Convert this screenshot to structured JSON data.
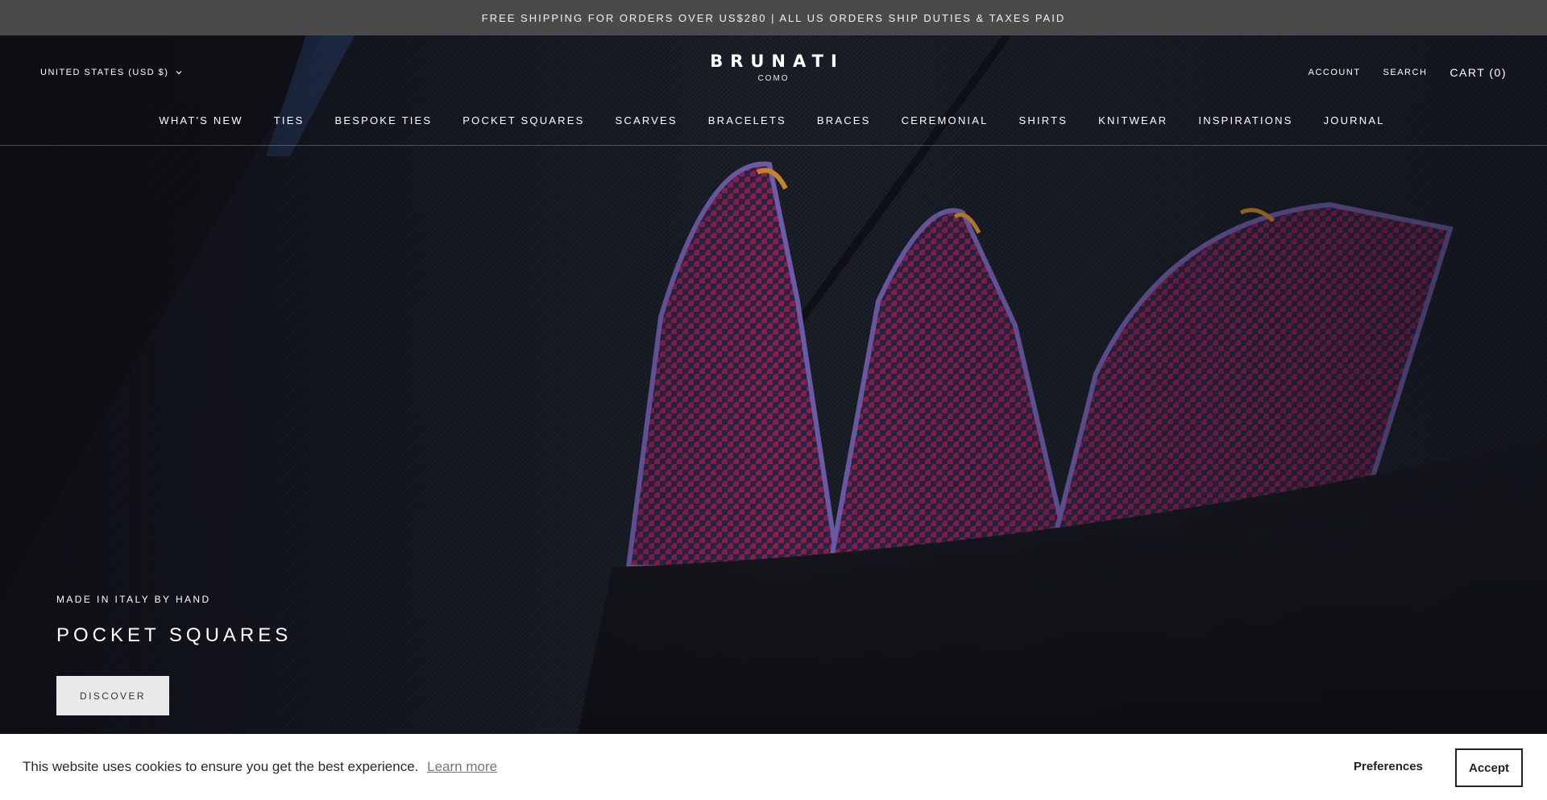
{
  "announcement": {
    "text": "FREE SHIPPING FOR ORDERS OVER US$280 | ALL US ORDERS SHIP DUTIES & TAXES PAID"
  },
  "header": {
    "locale": "UNITED STATES (USD $)",
    "logo": "BRUNATI",
    "logo_sub": "COMO",
    "account": "ACCOUNT",
    "search": "SEARCH",
    "cart": "CART (0)"
  },
  "nav": {
    "items": [
      {
        "label": "WHAT'S NEW"
      },
      {
        "label": "TIES"
      },
      {
        "label": "BESPOKE TIES"
      },
      {
        "label": "POCKET SQUARES"
      },
      {
        "label": "SCARVES"
      },
      {
        "label": "BRACELETS"
      },
      {
        "label": "BRACES"
      },
      {
        "label": "CEREMONIAL"
      },
      {
        "label": "SHIRTS"
      },
      {
        "label": "KNITWEAR"
      },
      {
        "label": "INSPIRATIONS"
      },
      {
        "label": "JOURNAL"
      }
    ]
  },
  "hero": {
    "kicker": "MADE IN ITALY BY HAND",
    "title": "POCKET SQUARES",
    "button": "DISCOVER"
  },
  "cookie": {
    "message": "This website uses cookies to ensure you get the best experience.",
    "learn_more": "Learn more",
    "preferences": "Preferences",
    "accept": "Accept"
  },
  "icons": {
    "locale_chevron": "chevron-down-icon"
  },
  "colors": {
    "announcement_bg": "#4a4a4a",
    "jacket": "#15181f",
    "pocket_square_magenta": "#8a1f4a",
    "button_bg": "#e9e9e9"
  }
}
